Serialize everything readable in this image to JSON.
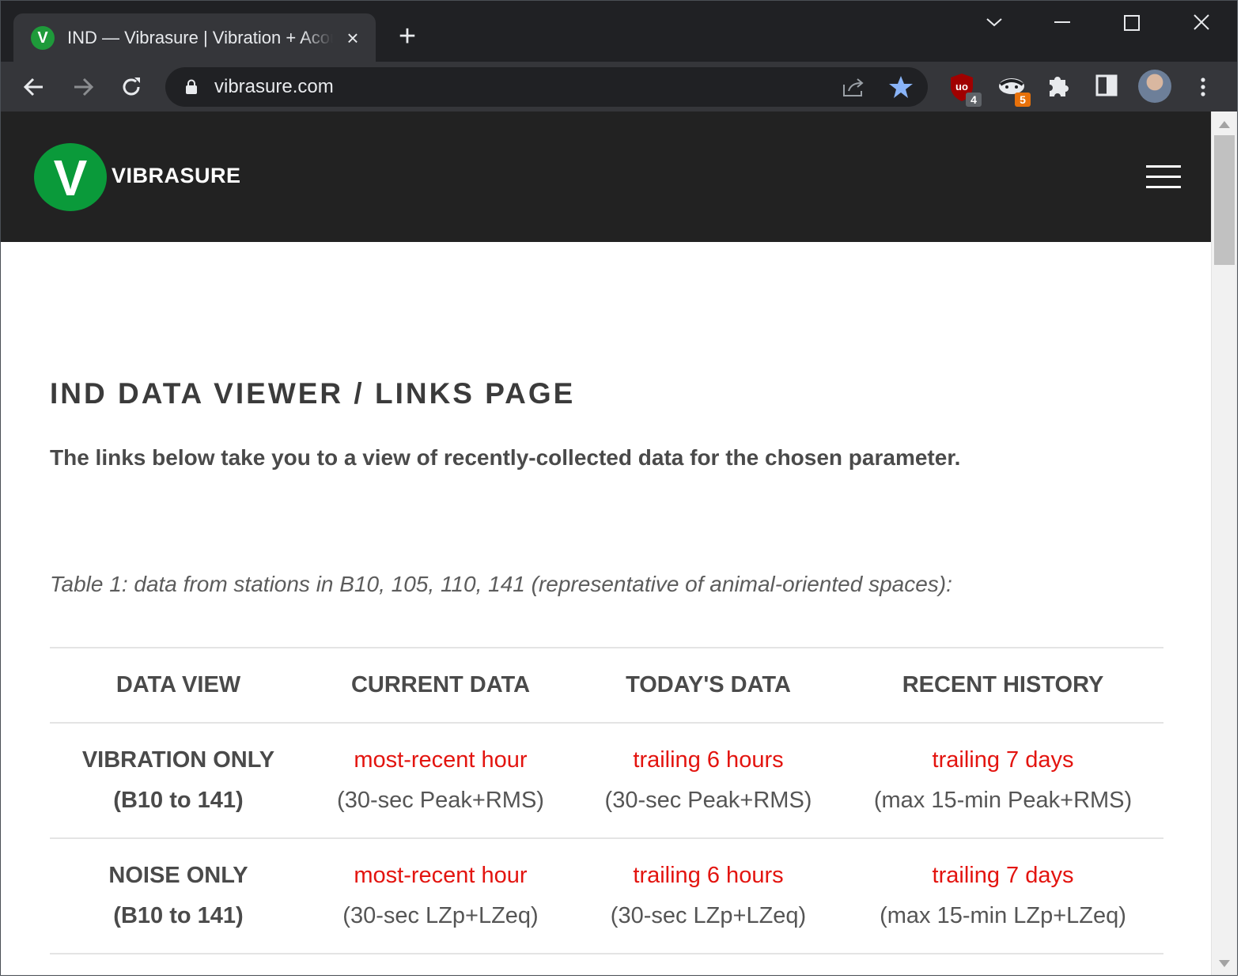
{
  "browser": {
    "tab_title": "IND — Vibrasure | Vibration + Acoustics",
    "tab_favicon_letter": "V",
    "new_tab_label": "+",
    "url": "vibrasure.com",
    "extensions": [
      {
        "name": "ublock-icon",
        "badge": "4",
        "badge_color": "#5f6368"
      },
      {
        "name": "badger-icon",
        "badge": "5",
        "badge_color": "#e8710a"
      }
    ],
    "accent_color": "#8ab4f8"
  },
  "site": {
    "logo_letter": "V",
    "logo_text": "VIBRASURE",
    "brand_color": "#0a9a3a",
    "header_bg": "#222222"
  },
  "page": {
    "title": "IND DATA VIEWER / LINKS PAGE",
    "intro": "The links below take you to a view of recently-collected data for the chosen parameter.",
    "table_caption": "Table 1: data from stations in B10, 105, 110, 141 (representative of animal-oriented spaces):",
    "table": {
      "headers": [
        "DATA VIEW",
        "CURRENT DATA",
        "TODAY'S DATA",
        "RECENT HISTORY"
      ],
      "rows": [
        {
          "view": "VIBRATION ONLY",
          "range": "(B10 to 141)",
          "cells": [
            {
              "link": "most-recent hour",
              "note": "(30-sec Peak+RMS)"
            },
            {
              "link": "trailing 6 hours",
              "note": "(30-sec Peak+RMS)"
            },
            {
              "link": "trailing 7 days",
              "note": "(max 15-min Peak+RMS)"
            }
          ]
        },
        {
          "view": "NOISE ONLY",
          "range": "(B10 to 141)",
          "cells": [
            {
              "link": "most-recent hour",
              "note": "(30-sec LZp+LZeq)"
            },
            {
              "link": "trailing 6 hours",
              "note": "(30-sec LZp+LZeq)"
            },
            {
              "link": "trailing 7 days",
              "note": "(max 15-min LZp+LZeq)"
            }
          ]
        }
      ]
    },
    "link_color": "#e3140f"
  }
}
